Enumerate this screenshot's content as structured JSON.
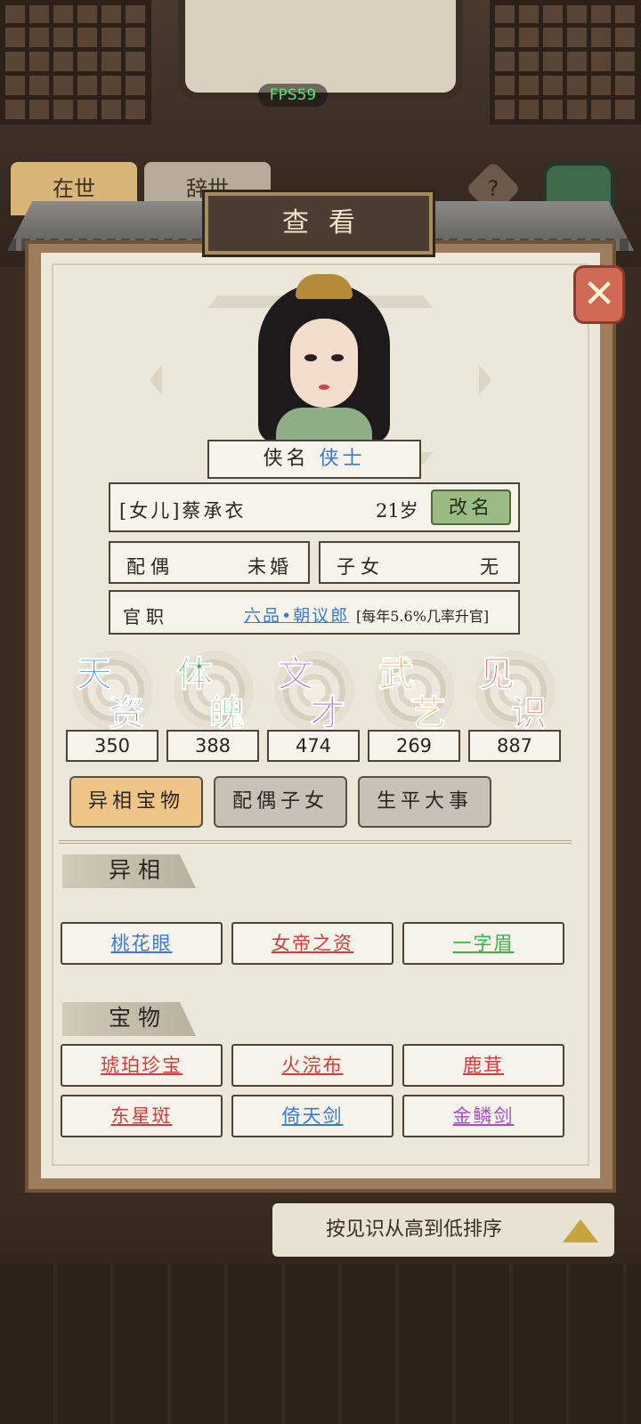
{
  "fps": "FPS59",
  "background": {
    "tab_alive": "在世",
    "tab_passed": "辞世",
    "help": "?",
    "sort_label": "按见识从高到低排序"
  },
  "panel": {
    "title": "查看",
    "close_icon": "close-x-icon"
  },
  "character": {
    "xia_label": "侠名",
    "xia_value": "侠士",
    "name": "[女儿]蔡承衣",
    "age": "21岁",
    "rename_button": "改名",
    "spouse_label": "配偶",
    "spouse_value": "未婚",
    "children_label": "子女",
    "children_value": "无",
    "office_label": "官职",
    "office_value": "六品•朝议郎",
    "office_note": "[每年5.6%几率升官]"
  },
  "stats": [
    {
      "c1": "天",
      "c2": "资",
      "value": "350",
      "color": "#3d7ad6"
    },
    {
      "c1": "体",
      "c2": "魄",
      "value": "388",
      "color": "#3fae4f"
    },
    {
      "c1": "文",
      "c2": "才",
      "value": "474",
      "color": "#9b4fd0"
    },
    {
      "c1": "武",
      "c2": "艺",
      "value": "269",
      "color": "#e0a02a"
    },
    {
      "c1": "见",
      "c2": "识",
      "value": "887",
      "color": "#d8504a"
    }
  ],
  "tabs": [
    {
      "label": "异相宝物",
      "active": true
    },
    {
      "label": "配偶子女",
      "active": false
    },
    {
      "label": "生平大事",
      "active": false
    }
  ],
  "traits": {
    "title": "异相",
    "items": [
      {
        "label": "桃花眼",
        "color": "#3a7ad0"
      },
      {
        "label": "女帝之资",
        "color": "#d63a3a"
      },
      {
        "label": "一字眉",
        "color": "#3fb04a"
      }
    ]
  },
  "treasures": {
    "title": "宝物",
    "items": [
      {
        "label": "琥珀珍宝",
        "color": "#d63a3a"
      },
      {
        "label": "火浣布",
        "color": "#d63a3a"
      },
      {
        "label": "鹿茸",
        "color": "#d63a3a"
      },
      {
        "label": "东星斑",
        "color": "#d63a3a"
      },
      {
        "label": "倚天剑",
        "color": "#3a7ad0"
      },
      {
        "label": "金鳞剑",
        "color": "#b04ad0"
      }
    ]
  }
}
